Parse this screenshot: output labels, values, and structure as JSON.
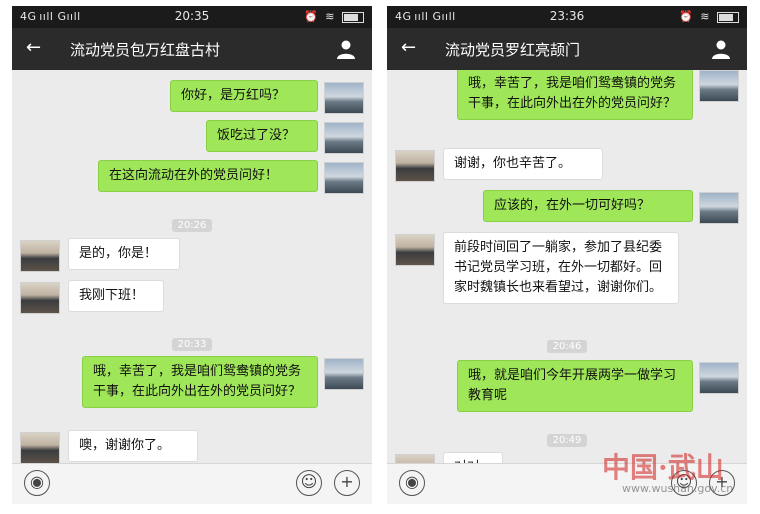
{
  "left": {
    "status": {
      "signal": "4G ııll  Gııll",
      "time": "20:35"
    },
    "title": "流动党员包万红盘古村",
    "messages": [
      {
        "text": "你好，是万红吗？"
      },
      {
        "text": "饭吃过了没？"
      },
      {
        "text": "在这向流动在外的党员问好！"
      },
      {
        "time": "20:26"
      },
      {
        "text": "是的，你是！"
      },
      {
        "text": "我刚下班！"
      },
      {
        "time": "20:33"
      },
      {
        "text": "哦，幸苦了，我是咱们鸳鸯镇的党务干事，在此向外出在外的党员问好？"
      },
      {
        "text": "噢，谢谢你了。"
      }
    ]
  },
  "right": {
    "status": {
      "signal": "4G ııll  Gııll",
      "time": "23:36"
    },
    "title": "流动党员罗红亮颉门",
    "messages": [
      {
        "text": "哦，幸苦了，我是咱们鸳鸯镇的党务干事，在此向外出在外的党员问好？"
      },
      {
        "text": "谢谢，你也辛苦了。"
      },
      {
        "text": "应该的，在外一切可好吗？"
      },
      {
        "text": "前段时间回了一躺家，参加了县纪委书记党员学习班，在外一切都好。回家时魏镇长也来看望过，谢谢你们。"
      },
      {
        "time": "20:46"
      },
      {
        "text": "哦，就是咱们今年开展两学一做学习教育呢"
      },
      {
        "time": "20:49"
      },
      {
        "text": "对对"
      }
    ]
  },
  "watermark": {
    "cn": "中国·武山",
    "en": "www.wushan.gov.cn"
  }
}
